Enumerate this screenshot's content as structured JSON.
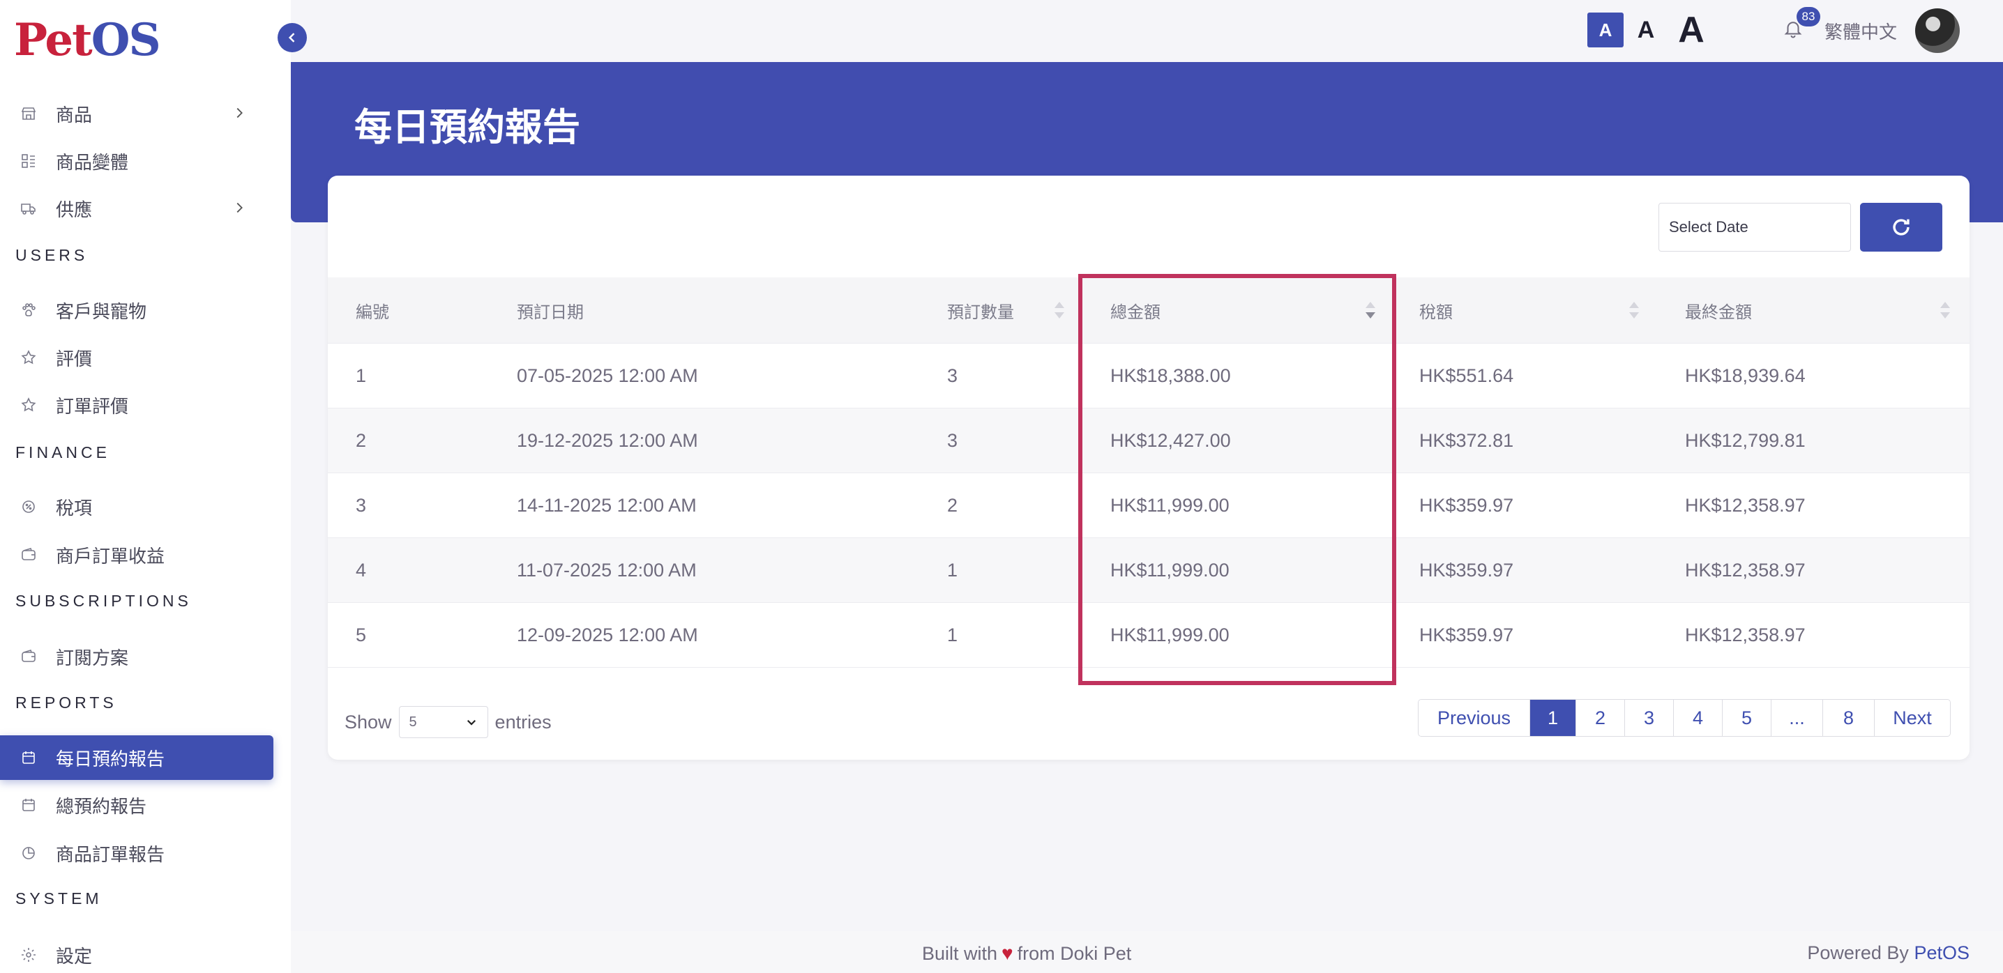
{
  "app": {
    "logo_part1": "Pet",
    "logo_part2": "OS"
  },
  "topbar": {
    "font_small": "A",
    "font_medium": "A",
    "font_large": "A",
    "notification_count": "83",
    "language": "繁體中文"
  },
  "sidebar": {
    "items_top": [
      {
        "label": "商品",
        "icon": "store-icon",
        "chevron": true
      },
      {
        "label": "商品變體",
        "icon": "variants-icon",
        "chevron": false
      },
      {
        "label": "供應",
        "icon": "truck-icon",
        "chevron": true
      }
    ],
    "section_users": "USERS",
    "items_users": [
      {
        "label": "客戶與寵物",
        "icon": "paw-icon"
      },
      {
        "label": "評價",
        "icon": "star-icon"
      },
      {
        "label": "訂單評價",
        "icon": "star-icon"
      }
    ],
    "section_finance": "FINANCE",
    "items_finance": [
      {
        "label": "稅項",
        "icon": "tax-icon"
      },
      {
        "label": "商戶訂單收益",
        "icon": "wallet-icon"
      }
    ],
    "section_subscriptions": "SUBSCRIPTIONS",
    "items_subscriptions": [
      {
        "label": "訂閱方案",
        "icon": "wallet-icon"
      }
    ],
    "section_reports": "REPORTS",
    "items_reports": [
      {
        "label": "每日預約報告",
        "icon": "calendar-icon",
        "active": true
      },
      {
        "label": "總預約報告",
        "icon": "calendar-icon"
      },
      {
        "label": "商品訂單報告",
        "icon": "pie-chart-icon"
      }
    ],
    "section_system": "SYSTEM",
    "items_system": [
      {
        "label": "設定",
        "icon": "gear-icon"
      }
    ]
  },
  "page": {
    "title": "每日預約報告"
  },
  "filters": {
    "date_placeholder": "Select Date"
  },
  "table": {
    "headers": [
      "編號",
      "預訂日期",
      "預訂數量",
      "總金額",
      "稅額",
      "最終金額"
    ],
    "rows": [
      [
        "1",
        "07-05-2025 12:00 AM",
        "3",
        "HK$18,388.00",
        "HK$551.64",
        "HK$18,939.64"
      ],
      [
        "2",
        "19-12-2025 12:00 AM",
        "3",
        "HK$12,427.00",
        "HK$372.81",
        "HK$12,799.81"
      ],
      [
        "3",
        "14-11-2025 12:00 AM",
        "2",
        "HK$11,999.00",
        "HK$359.97",
        "HK$12,358.97"
      ],
      [
        "4",
        "11-07-2025 12:00 AM",
        "1",
        "HK$11,999.00",
        "HK$359.97",
        "HK$12,358.97"
      ],
      [
        "5",
        "12-09-2025 12:00 AM",
        "1",
        "HK$11,999.00",
        "HK$359.97",
        "HK$12,358.97"
      ]
    ]
  },
  "entries": {
    "show": "Show",
    "value": "5",
    "suffix": "entries"
  },
  "pagination": {
    "previous": "Previous",
    "pages": [
      "1",
      "2",
      "3",
      "4",
      "5",
      "...",
      "8"
    ],
    "next": "Next",
    "current": "1"
  },
  "footer": {
    "built_prefix": "Built with",
    "built_suffix": "from Doki Pet",
    "powered_prefix": "Powered By",
    "powered_brand": "PetOS"
  },
  "colors": {
    "primary": "#3f4fb0",
    "brand_red": "#c8223c",
    "highlight": "#c0325d"
  }
}
